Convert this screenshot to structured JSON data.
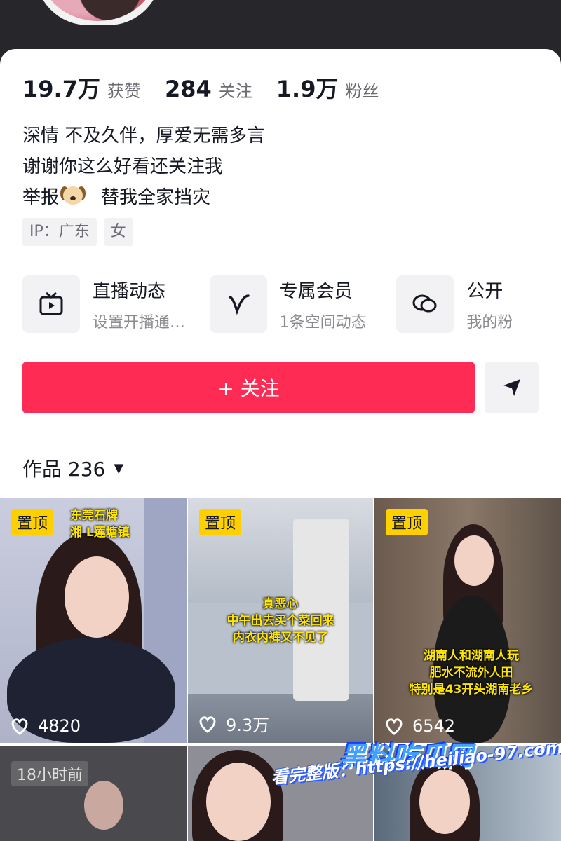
{
  "stats": [
    {
      "value": "19.7万",
      "label": "获赞"
    },
    {
      "value": "284",
      "label": "关注"
    },
    {
      "value": "1.9万",
      "label": "粉丝"
    }
  ],
  "bio": {
    "line1": "深情  不及久伴，厚爱无需多言",
    "line2": "谢谢你这么好看还关注我",
    "line3_prefix": "举报",
    "line3_emoji": "dog-emoji",
    "line3_suffix": "替我全家挡灾"
  },
  "tags": [
    "IP：广东",
    "女"
  ],
  "features": [
    {
      "icon": "tv-icon",
      "title": "直播动态",
      "subtitle": "设置开播通…"
    },
    {
      "icon": "v-icon",
      "title": "专属会员",
      "subtitle": "1条空间动态"
    },
    {
      "icon": "chat-icon",
      "title": "公开",
      "subtitle": "我的粉"
    }
  ],
  "follow_button": "+ 关注",
  "share_icon": "send-icon",
  "works": {
    "label": "作品 236",
    "caret": "▼"
  },
  "videos": [
    {
      "pinned": "置顶",
      "caption_line1": "东莞石牌",
      "caption_line2": "湘 L莲塘镇",
      "likes": "4820"
    },
    {
      "pinned": "置顶",
      "caption_line1": "真恶心",
      "caption_line2": "中午出去买个菜回来",
      "caption_line3": "内衣内裤又不见了",
      "likes": "9.3万"
    },
    {
      "pinned": "置顶",
      "caption_line1": "湖南人和湖南人玩",
      "caption_line2": "肥水不流外人田",
      "caption_line3": "特别是43开头湖南老乡",
      "likes": "6542"
    },
    {
      "time": "18小时前"
    }
  ],
  "watermark": {
    "site_name": "黑料吃瓜网",
    "line": "看完整版：https://heiliao-97.com"
  },
  "colors": {
    "accent": "#fe2c55",
    "pin": "#ffd000",
    "text": "#161823",
    "muted": "#6b6c73"
  }
}
